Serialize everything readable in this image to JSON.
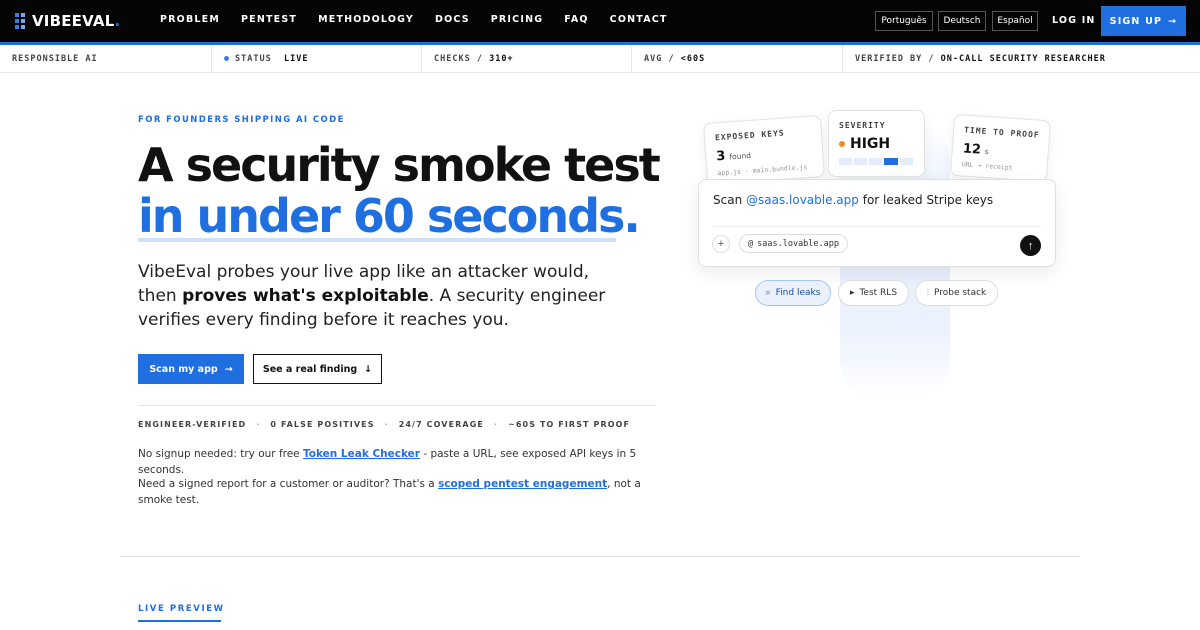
{
  "brand": {
    "name": "VIBEEVAL",
    "dot": "."
  },
  "nav": {
    "links": [
      "PROBLEM",
      "PENTEST",
      "METHODOLOGY",
      "DOCS",
      "PRICING",
      "FAQ",
      "CONTACT"
    ]
  },
  "languages": [
    "Português",
    "Deutsch",
    "Español"
  ],
  "auth": {
    "login": "LOG IN",
    "signup": "SIGN UP",
    "signup_icon": "→"
  },
  "status_bar": {
    "responsible": "RESPONSIBLE AI",
    "status_key": "STATUS",
    "status_val": "LIVE",
    "checks_key": "CHECKS /",
    "checks_val": "310+",
    "avg_key": "AVG /",
    "avg_val": "<60S",
    "verified_key": "VERIFIED BY /",
    "verified_val": "ON-CALL SECURITY RESEARCHER"
  },
  "hero": {
    "eyebrow": "FOR FOUNDERS SHIPPING AI CODE",
    "title_line1": "A security smoke test",
    "title_line2": "in under 60 seconds.",
    "lead_pre": "VibeEval probes your live app like an attacker would, then ",
    "lead_bold": "proves what's exploitable",
    "lead_post": ". A security engineer verifies every finding before it reaches you.",
    "primary_button": "Scan my app",
    "primary_icon": "→",
    "secondary_button": "See a real finding",
    "secondary_icon": "↓",
    "trust": [
      "ENGINEER-VERIFIED",
      "0 FALSE POSITIVES",
      "24/7 COVERAGE",
      "~60S TO FIRST PROOF"
    ],
    "trust_sep": "·",
    "note1_pre": "No signup needed: try our free ",
    "note1_link": "Token Leak Checker",
    "note1_post": " - paste a URL, see exposed API keys in 5 seconds.",
    "note2_pre": "Need a signed report for a customer or auditor? That's a ",
    "note2_link": "scoped pentest engagement",
    "note2_post": ", not a smoke test."
  },
  "cards": {
    "keys_label": "EXPOSED KEYS",
    "keys_count": "3",
    "keys_found": "found",
    "keys_files": "app.js · main.bundle.js",
    "severity_label": "SEVERITY",
    "severity_value": "HIGH",
    "time_label": "TIME TO PROOF",
    "time_value": "12",
    "time_unit": "s",
    "time_sub": "URL → receipt"
  },
  "prompt": {
    "pre": "Scan ",
    "highlight": "@saas.lovable.app",
    "post": " for leaked Stripe keys",
    "plus": "+",
    "chip_at": "@",
    "chip_text": "saas.lovable.app",
    "send_icon": "↑"
  },
  "pills": [
    {
      "icon": "⌕",
      "label": "Find leaks"
    },
    {
      "icon": "▸",
      "label": "Test RLS"
    },
    {
      "icon": "⫶",
      "label": "Probe stack"
    }
  ],
  "section": {
    "live_preview": "LIVE PREVIEW"
  },
  "colors": {
    "accent": "#1f6fe0",
    "severity_high": "#f08a24",
    "nav_bg": "#050505"
  }
}
